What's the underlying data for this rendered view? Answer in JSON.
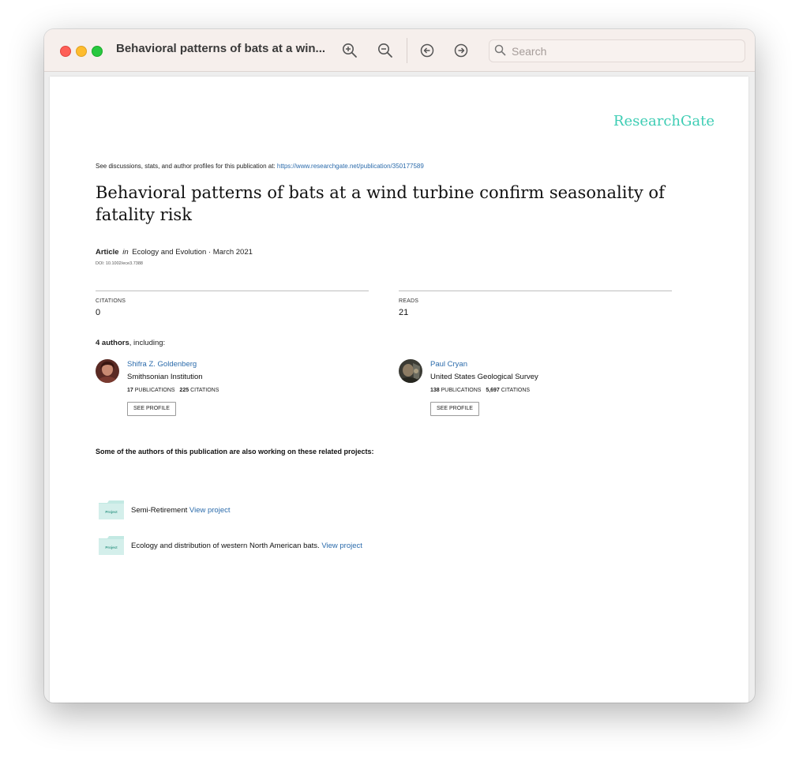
{
  "window": {
    "title": "Behavioral patterns of bats at a win...",
    "search": {
      "placeholder": "Search",
      "value": ""
    }
  },
  "toolbar": {
    "icons": [
      "zoom-in-icon",
      "zoom-out-icon",
      "back-icon",
      "forward-icon",
      "search-icon"
    ]
  },
  "document": {
    "brand": "ResearchGate",
    "see_discussions_text": "See discussions, stats, and author profiles for this publication at:",
    "publication_url": "https://www.researchgate.net/publication/350177589",
    "title": "Behavioral patterns of bats at a wind turbine confirm seasonality of fatality risk",
    "article_type": "Article",
    "article_in": "in",
    "journal_and_date": "Ecology and Evolution · March 2021",
    "doi": "DOI: 10.1002/ece3.7388",
    "citations_label": "CITATIONS",
    "citations_value": "0",
    "reads_label": "READS",
    "reads_value": "21",
    "authors_count_bold": "4 authors",
    "authors_count_rest": ", including:",
    "authors": [
      {
        "name": "Shifra Z. Goldenberg",
        "institution": "Smithsonian Institution",
        "publications": "17",
        "publications_label": "PUBLICATIONS",
        "citations": "225",
        "citations_label": "CITATIONS",
        "see_profile": "SEE PROFILE"
      },
      {
        "name": "Paul Cryan",
        "institution": "United States Geological Survey",
        "publications": "138",
        "publications_label": "PUBLICATIONS",
        "citations": "5,697",
        "citations_label": "CITATIONS",
        "see_profile": "SEE PROFILE"
      }
    ],
    "related_heading": "Some of the authors of this publication are also working on these related projects:",
    "projects": [
      {
        "icon_label": "Project",
        "name": "Semi-Retirement",
        "link": "View project"
      },
      {
        "icon_label": "Project",
        "name": "Ecology and distribution of western North American bats.",
        "link": "View project"
      }
    ]
  },
  "colors": {
    "brand": "#3ecdb4",
    "link": "#2b6bab",
    "titlebar": "#f6efec"
  }
}
